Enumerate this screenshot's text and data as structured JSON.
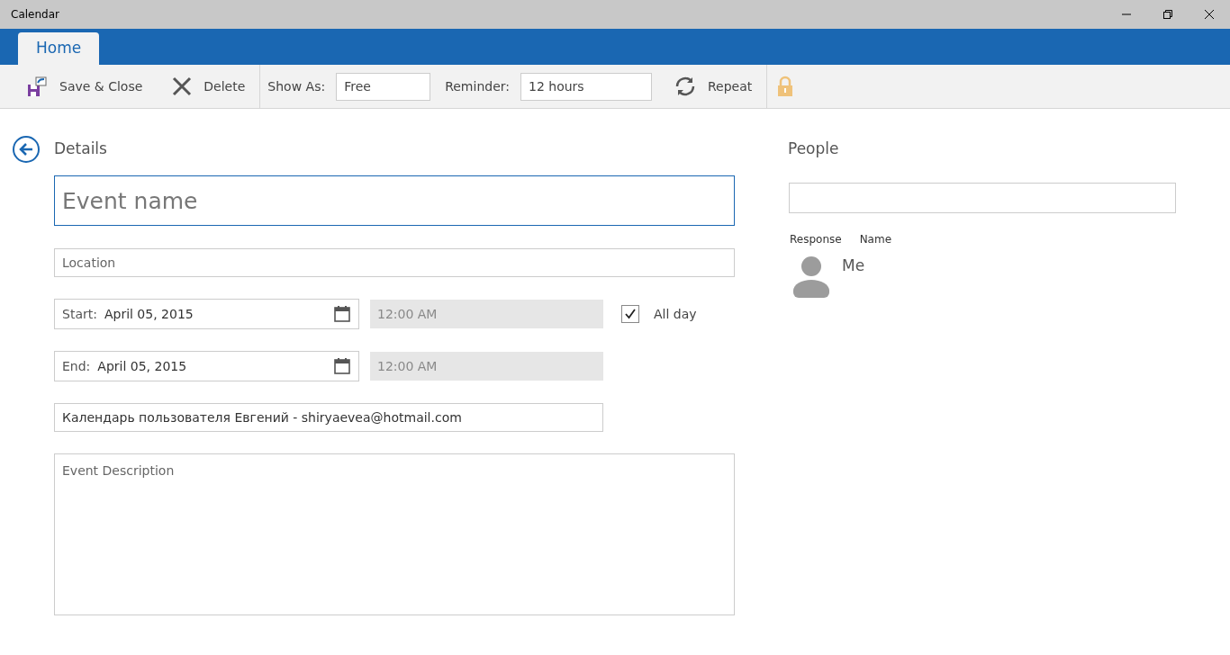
{
  "window": {
    "title": "Calendar"
  },
  "tabs": [
    {
      "label": "Home",
      "selected": true
    }
  ],
  "toolbar": {
    "save_close": "Save & Close",
    "delete": "Delete",
    "show_as": {
      "label": "Show As:",
      "value": "Free"
    },
    "reminder": {
      "label": "Reminder:",
      "value": "12 hours"
    },
    "repeat": "Repeat",
    "private": false
  },
  "details": {
    "heading": "Details",
    "event_name": {
      "placeholder": "Event name"
    },
    "location": {
      "placeholder": "Location"
    },
    "start": {
      "label": "Start:",
      "date": "April 05, 2015",
      "time": "12:00 AM",
      "time_disabled": true
    },
    "end": {
      "label": "End:",
      "date": "April 05, 2015",
      "time": "12:00 AM",
      "time_disabled": true
    },
    "all_day": {
      "label": "All day",
      "checked": true
    },
    "calendar": "Календарь пользователя Евгений - shiryaevea@hotmail.com",
    "description": {
      "placeholder": "Event Description"
    }
  },
  "people": {
    "heading": "People",
    "columns": [
      "Response",
      "Name"
    ],
    "attendees": [
      {
        "name": "Me"
      }
    ]
  }
}
